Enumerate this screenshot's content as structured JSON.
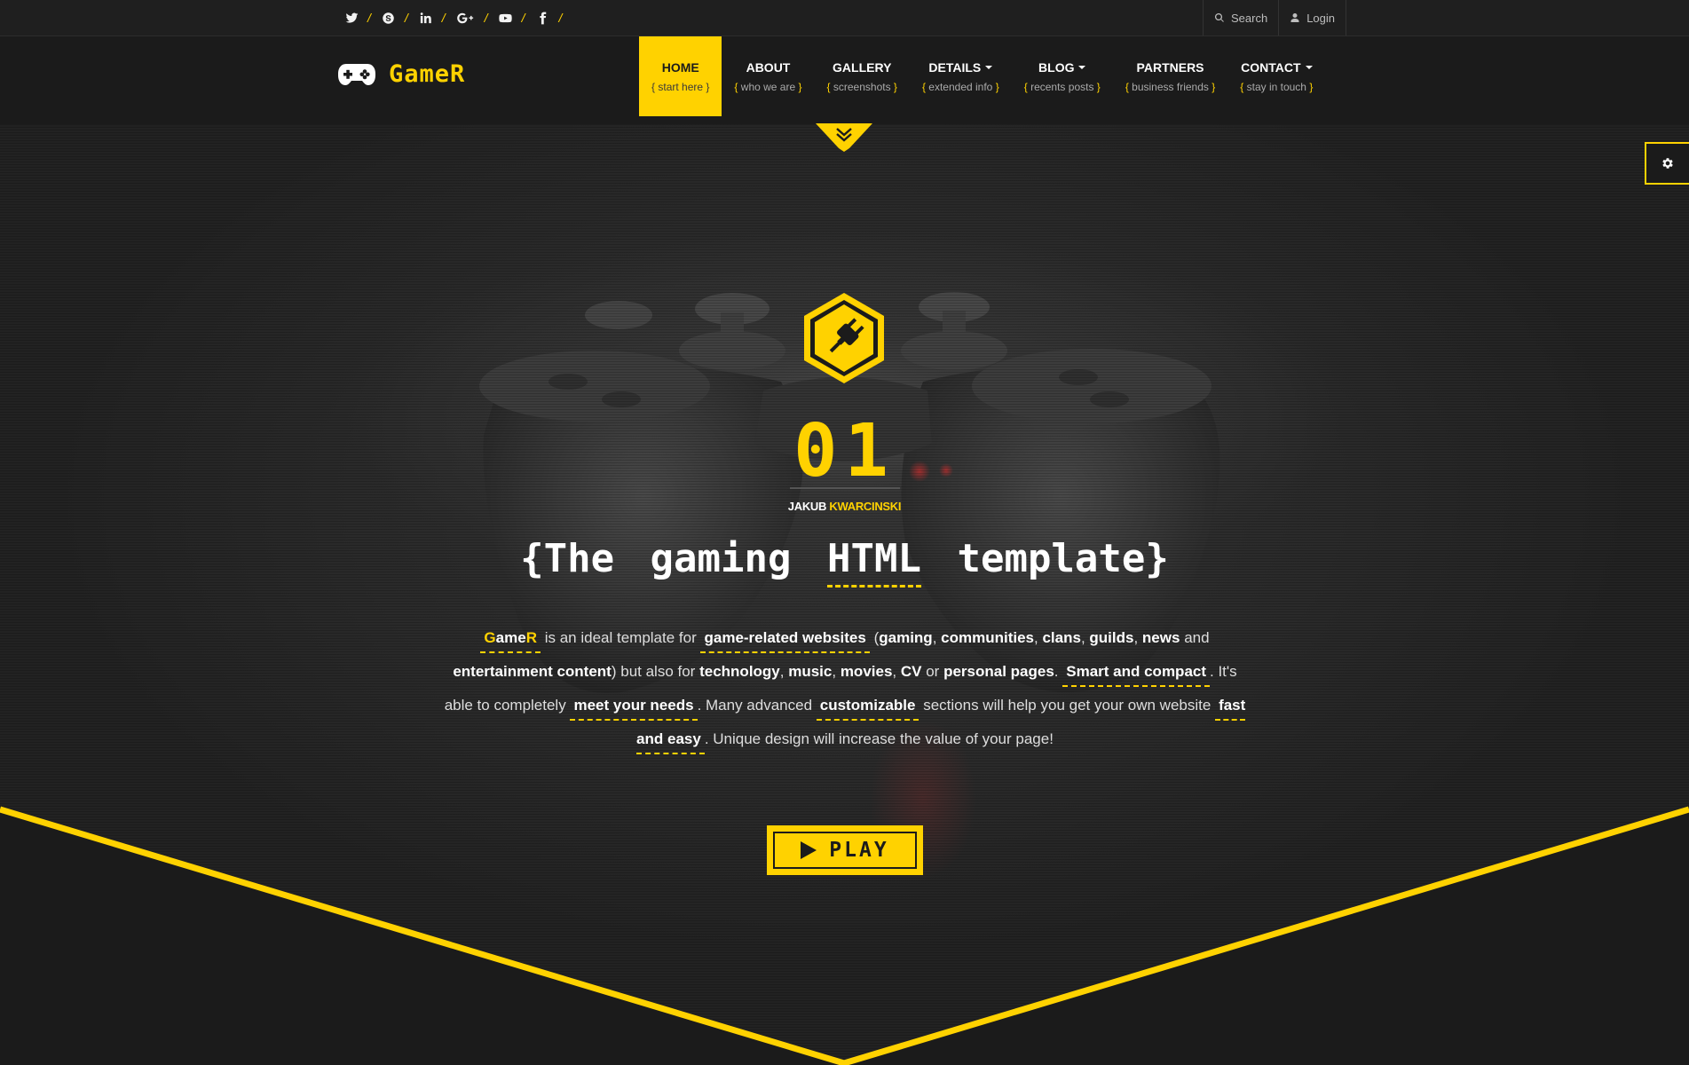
{
  "topbar": {
    "social": [
      {
        "name": "twitter-icon"
      },
      {
        "name": "skype-icon"
      },
      {
        "name": "linkedin-icon"
      },
      {
        "name": "google-plus-icon"
      },
      {
        "name": "youtube-icon"
      },
      {
        "name": "facebook-icon"
      }
    ],
    "separator": "/",
    "search_label": "Search",
    "login_label": "Login"
  },
  "header": {
    "logo_text": "GameR",
    "nav": [
      {
        "label": "HOME",
        "sub": "start here",
        "active": true,
        "dropdown": false
      },
      {
        "label": "ABOUT",
        "sub": "who we are",
        "active": false,
        "dropdown": false
      },
      {
        "label": "GALLERY",
        "sub": "screenshots",
        "active": false,
        "dropdown": false
      },
      {
        "label": "DETAILS",
        "sub": "extended info",
        "active": false,
        "dropdown": true
      },
      {
        "label": "BLOG",
        "sub": "recents posts",
        "active": false,
        "dropdown": true
      },
      {
        "label": "PARTNERS",
        "sub": "business friends",
        "active": false,
        "dropdown": false
      },
      {
        "label": "CONTACT",
        "sub": "stay in touch",
        "active": false,
        "dropdown": true
      }
    ],
    "brace_open": "{",
    "brace_close": "}"
  },
  "hero": {
    "number": "01",
    "author_first": "JAKUB",
    "author_last": "KWARCINSKI",
    "headline_before": "{The gaming",
    "headline_highlight": "HTML",
    "headline_after": "template}",
    "desc": {
      "gamer_g": "G",
      "gamer_ame": "ame",
      "gamer_r": "R",
      "t1": "is an ideal template for",
      "u1": "game-related websites",
      "t2": "(",
      "b1": "gaming",
      "b2": "communities",
      "b3": "clans",
      "b4": "guilds",
      "b5": "news",
      "t3": "and",
      "b6": "entertainment content",
      "t4": ") but also for",
      "b7": "technology",
      "b8": "music",
      "b9": "movies",
      "b10": "CV",
      "t5": "or",
      "b11": "personal pages",
      "u2": "Smart and compact",
      "t6": ". It's able to completely",
      "u3": "meet your needs",
      "t7": ". Many advanced",
      "u4": "customizable",
      "t8": "sections will help you get your own website",
      "u5": "fast and easy",
      "t9": ". Unique design will increase the value of your page!"
    },
    "play_label": "PLAY"
  },
  "colors": {
    "accent": "#ffd200",
    "background": "#1b1b1b"
  },
  "icons": {
    "logo": "gamepad-icon",
    "hero": "plug-icon",
    "settings": "gear-icon",
    "search": "search-icon",
    "login": "user-icon",
    "scroll": "chevron-double-down-icon",
    "play": "play-icon"
  }
}
